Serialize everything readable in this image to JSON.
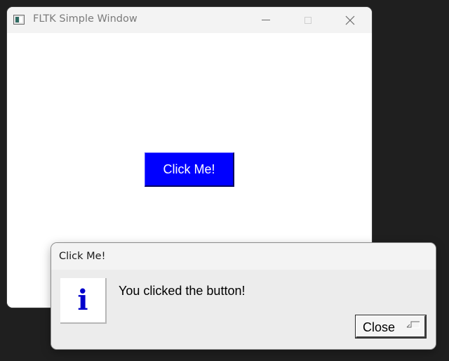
{
  "main_window": {
    "title": "FLTK Simple Window",
    "button_label": "Click Me!",
    "button_color": "#0000ff",
    "controls": {
      "minimize_icon": "minimize-icon",
      "maximize_icon": "maximize-icon",
      "close_icon": "close-icon"
    }
  },
  "dialog": {
    "title": "Click Me!",
    "icon": "i",
    "icon_color": "#0000cc",
    "message": "You clicked the button!",
    "close_label": "Close",
    "close_shortcut_icon": "return-key-icon"
  }
}
